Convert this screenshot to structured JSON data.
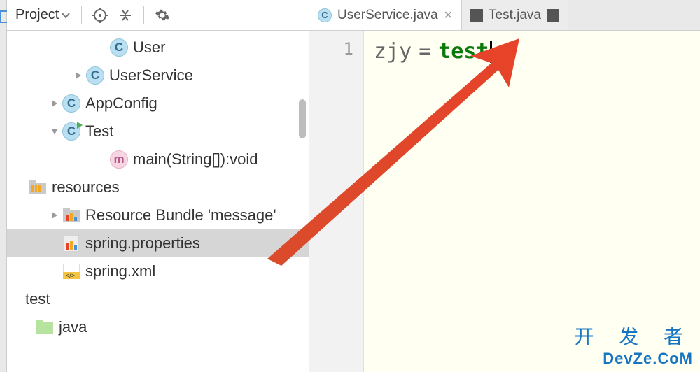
{
  "toolbar": {
    "title": "Project"
  },
  "tree": {
    "items": [
      {
        "indent": 120,
        "arrow": "",
        "icon": "class",
        "label": "User"
      },
      {
        "indent": 86,
        "arrow": "right",
        "icon": "class",
        "label": "UserService"
      },
      {
        "indent": 52,
        "arrow": "right",
        "icon": "class",
        "label": "AppConfig"
      },
      {
        "indent": 52,
        "arrow": "down",
        "icon": "class-run",
        "label": "Test"
      },
      {
        "indent": 120,
        "arrow": "",
        "icon": "method",
        "label": "main(String[]):void"
      },
      {
        "indent": 4,
        "arrow": "",
        "icon": "folder-res",
        "label": "resources"
      },
      {
        "indent": 52,
        "arrow": "right",
        "icon": "bundle",
        "label": "Resource Bundle 'message'"
      },
      {
        "indent": 52,
        "arrow": "",
        "icon": "props",
        "label": "spring.properties",
        "selected": true
      },
      {
        "indent": 52,
        "arrow": "",
        "icon": "xml",
        "label": "spring.xml"
      },
      {
        "indent": 0,
        "arrow": "",
        "icon": "",
        "label": "test"
      },
      {
        "indent": 14,
        "arrow": "",
        "icon": "folder-green",
        "label": "java"
      }
    ]
  },
  "tabs": [
    {
      "icon": "class",
      "label": "UserService.java",
      "active": true,
      "closable": true
    },
    {
      "icon": "square",
      "label": "Test.java",
      "active": false,
      "closable": false,
      "trailingSquare": true
    }
  ],
  "editor": {
    "lineNumber": "1",
    "key": "zjy",
    "eq": "=",
    "value": "test"
  },
  "watermark": {
    "cn": "开 发 者",
    "en": "DevZe.CoM"
  }
}
